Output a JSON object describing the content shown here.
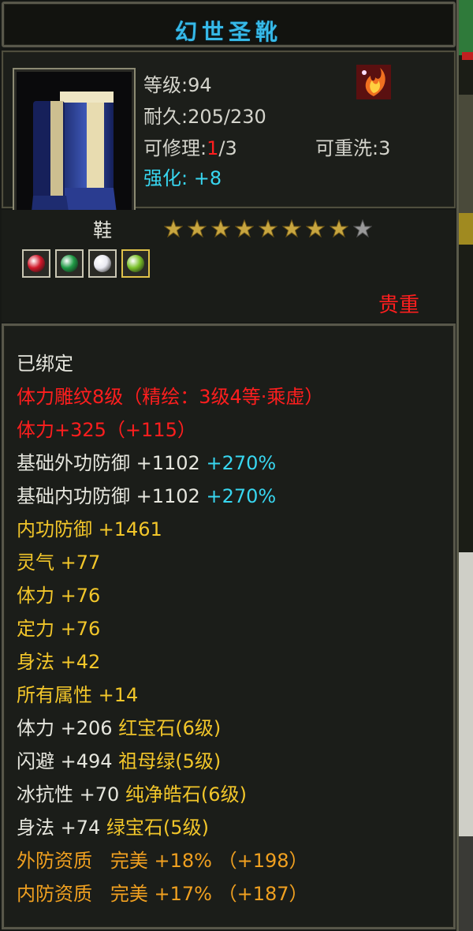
{
  "item": {
    "name": "幻世圣靴",
    "icon": "boots-icon",
    "level": "等级:94",
    "durability": "耐久:205/230",
    "repairable_label": "可修理:",
    "repairable_used": "1",
    "repairable_max": "/3",
    "rewash": "可重洗:3",
    "enhance_label": "强化:",
    "enhance_value": "+8",
    "type": "鞋",
    "stars_filled": 8,
    "stars_total": 9,
    "rarity": "贵重",
    "bound": "已绑定"
  },
  "engrave": {
    "line": "体力雕纹8级（精绘：3级4等·乘虚）",
    "bonus_prefix": "体力+325（",
    "bonus_value": "+115",
    "bonus_suffix": "）"
  },
  "base_defense": [
    {
      "label": "基础外功防御",
      "value": "+1102",
      "percent": "+270%"
    },
    {
      "label": "基础内功防御",
      "value": "+1102",
      "percent": "+270%"
    }
  ],
  "stats": [
    {
      "label": "内功防御",
      "value": "+1461"
    },
    {
      "label": "灵气",
      "value": "+77"
    },
    {
      "label": "体力",
      "value": "+76"
    },
    {
      "label": "定力",
      "value": "+76"
    },
    {
      "label": "身法",
      "value": "+42"
    },
    {
      "label": "所有属性",
      "value": "+14"
    }
  ],
  "gem_stats": [
    {
      "label": "体力",
      "value": "+206",
      "gem": "红宝石(6级)"
    },
    {
      "label": "闪避",
      "value": "+494",
      "gem": "祖母绿(5级)"
    },
    {
      "label": "冰抗性",
      "value": "+70",
      "gem": "纯净皓石(6级)"
    },
    {
      "label": "身法",
      "value": "+74",
      "gem": "绿宝石(5级)"
    }
  ],
  "qualities": [
    {
      "label": "外防资质",
      "grade": "完美",
      "percent": "+18%",
      "bonus": "（+198）"
    },
    {
      "label": "内防资质",
      "grade": "完美",
      "percent": "+17%",
      "bonus": "（+187）"
    }
  ],
  "gems": [
    {
      "name": "red-gem-icon",
      "color": "#d0182a"
    },
    {
      "name": "green-jade-icon",
      "color": "#1f9a45"
    },
    {
      "name": "white-diamond-icon",
      "color": "#e8e8f0"
    },
    {
      "name": "green-gem-icon",
      "color": "#7ac02a"
    }
  ],
  "colors": {
    "title": "#36b9e8",
    "red": "#ff1e1e",
    "cyan": "#38d6f0",
    "yellow": "#f2c62a",
    "orange": "#f0a020"
  }
}
